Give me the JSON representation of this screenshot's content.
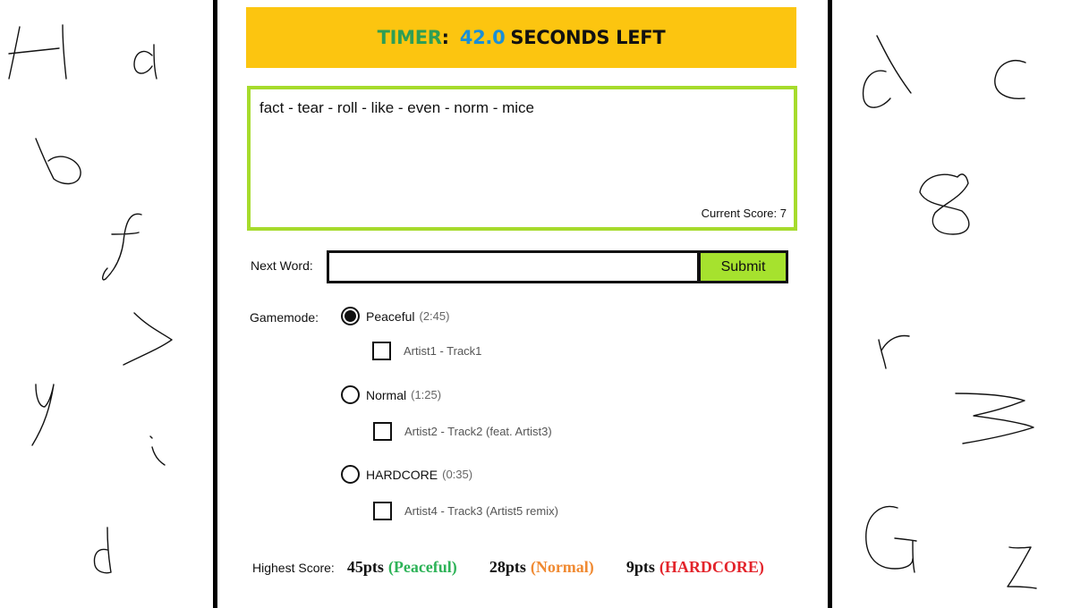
{
  "colors": {
    "timer_bg": "#fcc510",
    "timer_label": "#2e9e55",
    "timer_value": "#1a8fd6",
    "word_box_border": "#a6db2c",
    "submit_bg": "#a6e22e",
    "peaceful": "#2eb358",
    "normal": "#f08a32",
    "hardcore": "#e3242b"
  },
  "timer": {
    "label": "TIMER",
    "colon": ":",
    "value": "42.0",
    "suffix": "SECONDS LEFT"
  },
  "word_chain": "fact - tear - roll - like - even - norm - mice",
  "score": {
    "label": "Current Score:",
    "value": "7"
  },
  "next_word": {
    "label": "Next Word:",
    "value": "",
    "submit_label": "Submit"
  },
  "gamemode": {
    "label": "Gamemode:",
    "modes": [
      {
        "name": "Peaceful",
        "time": "(2:45)",
        "selected": true,
        "track": "Artist1 - Track1"
      },
      {
        "name": "Normal",
        "time": "(1:25)",
        "selected": false,
        "track": "Artist2 - Track2 (feat. Artist3)"
      },
      {
        "name": "HARDCORE",
        "time": "(0:35)",
        "selected": false,
        "track": "Artist4 - Track3 (Artist5 remix)"
      }
    ]
  },
  "highscore": {
    "label": "Highest Score:",
    "entries": [
      {
        "points": "45pts",
        "mode": "(Peaceful)"
      },
      {
        "points": "28pts",
        "mode": "(Normal)"
      },
      {
        "points": "9pts",
        "mode": "(HARDCORE)"
      }
    ]
  },
  "doodle_letters": {
    "left": [
      "H",
      "a",
      "b",
      "f",
      "J",
      "y",
      "i",
      "d"
    ],
    "right": [
      "d",
      "c",
      "8",
      "r",
      "3",
      "G",
      "z"
    ]
  }
}
